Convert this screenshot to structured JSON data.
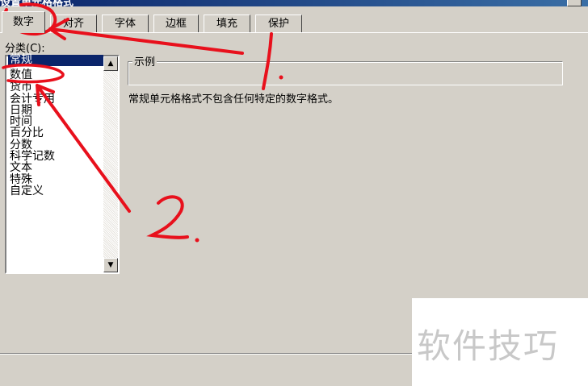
{
  "window": {
    "title": "设置单元格格式"
  },
  "tabs": [
    {
      "label": "数字"
    },
    {
      "label": "对齐"
    },
    {
      "label": "字体"
    },
    {
      "label": "边框"
    },
    {
      "label": "填充"
    },
    {
      "label": "保护"
    }
  ],
  "category": {
    "label": "分类(C):",
    "items": [
      "常规",
      "数值",
      "货币",
      "会计专用",
      "日期",
      "时间",
      "百分比",
      "分数",
      "科学记数",
      "文本",
      "特殊",
      "自定义"
    ],
    "selected": "常规"
  },
  "sample": {
    "legend": "示例",
    "description": "常规单元格格式不包含任何特定的数字格式。"
  },
  "watermark": {
    "text": "软件技巧"
  },
  "annotations": {
    "step1": "1.",
    "step2": "2."
  },
  "colors": {
    "dialog_bg": "#d4d0c8",
    "selection": "#0a246a",
    "annotation": "#e8101c"
  }
}
